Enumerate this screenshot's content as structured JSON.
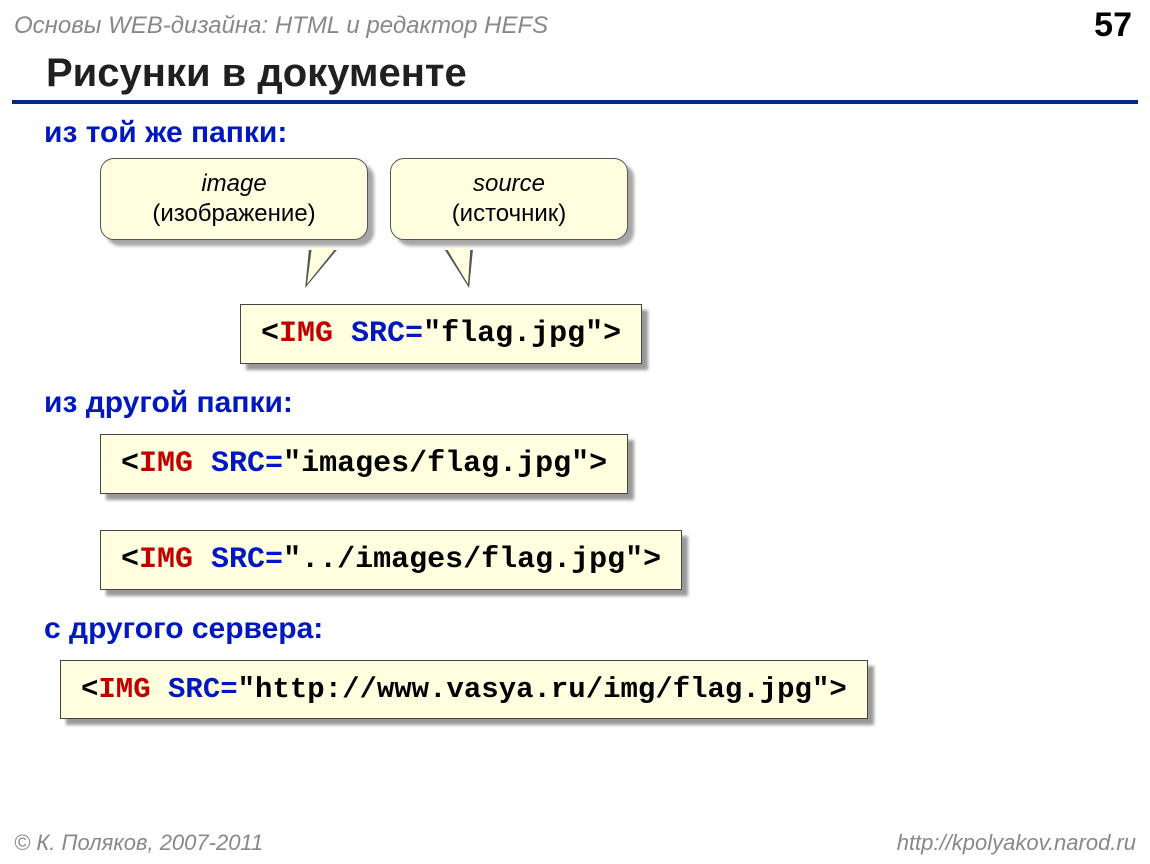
{
  "header": {
    "breadcrumb": "Основы WEB-дизайна: HTML и редактор HEFS",
    "page_number": "57"
  },
  "title": "Рисунки в документе",
  "section_same_folder": "из той же папки:",
  "callout_image": {
    "en": "image",
    "ru": "(изображение)"
  },
  "callout_source": {
    "en": "source",
    "ru": "(источник)"
  },
  "code1": {
    "open": "<",
    "tag": "IMG",
    "sp": " ",
    "attr": "SRC=",
    "val": "\"flag.jpg\"",
    "close": ">"
  },
  "section_other_folder": "из другой папки:",
  "code2": {
    "open": "<",
    "tag": "IMG",
    "sp": " ",
    "attr": "SRC=",
    "val": "\"images/flag.jpg\"",
    "close": ">"
  },
  "code3": {
    "open": "<",
    "tag": "IMG",
    "sp": " ",
    "attr": "SRC=",
    "val": "\"../images/flag.jpg\"",
    "close": ">"
  },
  "section_other_server": "с другого сервера:",
  "code4": {
    "open": "<",
    "tag": "IMG",
    "sp": " ",
    "attr": "SRC=",
    "val": "\"http://www.vasya.ru/img/flag.jpg\"",
    "close": ">"
  },
  "footer": {
    "copyright": "© К. Поляков, 2007-2011",
    "url": "http://kpolyakov.narod.ru"
  }
}
